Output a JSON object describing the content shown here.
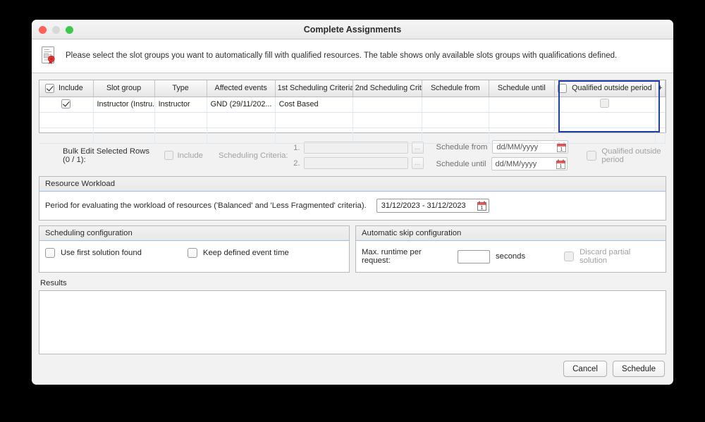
{
  "window": {
    "title": "Complete Assignments",
    "traffic_lights": [
      "close-red",
      "minimize-gray",
      "zoom-green"
    ]
  },
  "banner": {
    "icon": "document-seal-icon",
    "text": "Please select the slot groups you want to automatically fill with qualified resources. The table shows only available slots groups with qualifications defined."
  },
  "table": {
    "columns": [
      "Include",
      "Slot group",
      "Type",
      "Affected events",
      "1st Scheduling Criteria",
      "2nd Scheduling Crit...",
      "Schedule from",
      "Schedule until",
      "Qualified outside period"
    ],
    "add_column_label": "+",
    "header_include_checked": true,
    "header_qualified_checked": false,
    "rows": [
      {
        "include": true,
        "slot_group": "Instructor (Instru...",
        "type": "Instructor",
        "affected_events": "GND (29/11/202...",
        "criteria_1": "Cost Based",
        "criteria_2": "",
        "schedule_from": "",
        "schedule_until": "",
        "qualified_outside_period": false
      }
    ],
    "selection_color": "#1f3fa8"
  },
  "bulk_edit": {
    "label": "Bulk Edit Selected Rows (0 / 1):",
    "include_label": "Include",
    "include_checked": false,
    "criteria_label": "Scheduling Criteria:",
    "criteria_rows": [
      {
        "num": "1.",
        "value": "",
        "button": "..."
      },
      {
        "num": "2.",
        "value": "",
        "button": "..."
      }
    ],
    "schedule_from_label": "Schedule from",
    "schedule_from_value": "dd/MM/yyyy",
    "schedule_until_label": "Schedule until",
    "schedule_until_value": "dd/MM/yyyy",
    "qualified_outside_label": "Qualified outside period",
    "qualified_outside_checked": false
  },
  "resource_workload": {
    "title": "Resource Workload",
    "description": "Period for evaluating the workload of resources ('Balanced' and 'Less Fragmented' criteria).",
    "period_value": "31/12/2023 - 31/12/2023"
  },
  "scheduling_configuration": {
    "title": "Scheduling configuration",
    "use_first_solution_label": "Use first solution found",
    "use_first_solution_checked": false,
    "keep_event_time_label": "Keep defined event time",
    "keep_event_time_checked": false
  },
  "automatic_skip_configuration": {
    "title": "Automatic skip configuration",
    "max_runtime_label": "Max. runtime per request:",
    "max_runtime_value": "",
    "seconds_label": "seconds",
    "discard_partial_label": "Discard partial solution",
    "discard_partial_checked": false
  },
  "results": {
    "label": "Results",
    "content": ""
  },
  "footer": {
    "cancel_label": "Cancel",
    "schedule_label": "Schedule"
  }
}
